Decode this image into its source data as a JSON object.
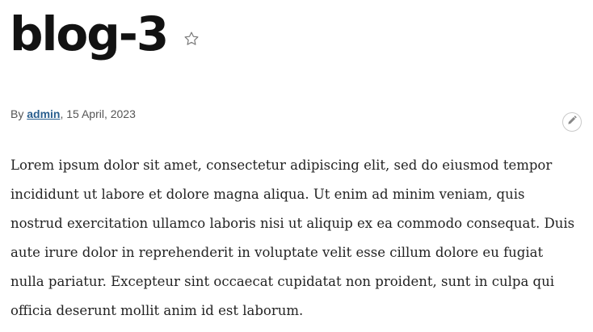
{
  "page": {
    "title": "blog-3"
  },
  "byline": {
    "prefix": "By ",
    "author": "admin",
    "date_sep": ", ",
    "date": "15 April, 2023"
  },
  "body": {
    "paragraph": "Lorem ipsum dolor sit amet, consectetur adipiscing elit, sed do eiusmod tempor incididunt ut labore et dolore magna aliqua. Ut enim ad minim veniam, quis nostrud exercitation ullamco laboris nisi ut aliquip ex ea commodo consequat. Duis aute irure dolor in reprehenderit in voluptate velit esse cillum dolore eu fugiat nulla pariatur. Excepteur sint occaecat cupidatat non proident, sunt in culpa qui officia deserunt mollit anim id est laborum."
  },
  "icons": {
    "favorite": "star-icon",
    "edit": "pencil-icon"
  },
  "colors": {
    "title": "#121212",
    "author_link": "#2a5f8f",
    "byline": "#555555",
    "body_text": "#232323"
  }
}
